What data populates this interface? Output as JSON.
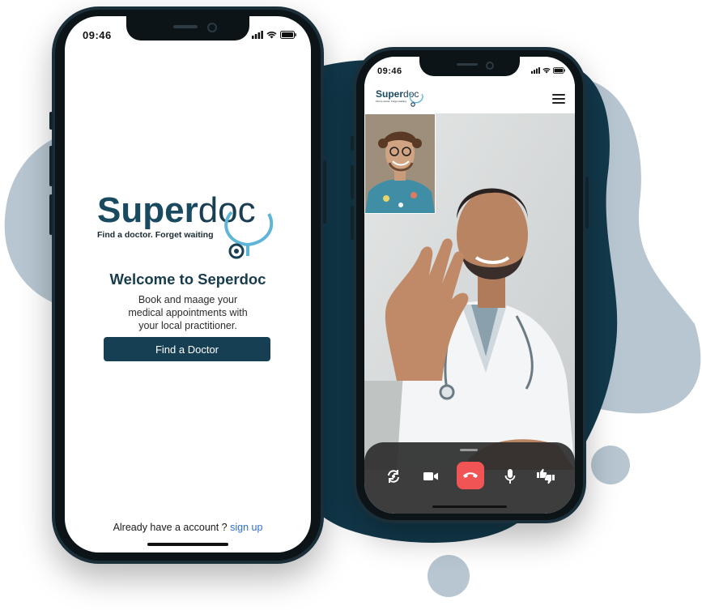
{
  "phone1": {
    "status_time": "09:46",
    "logo": {
      "part1": "Super",
      "part2": "doc",
      "tagline": "Find a doctor. Forget waiting"
    },
    "welcome_title": "Welcome to Seperdoc",
    "description_lines": [
      "Book and maage your",
      "medical appointments with",
      "your local practitioner."
    ],
    "cta_label": "Find a Doctor",
    "signup_prompt": "Already have a account ?",
    "signup_link": "sign up"
  },
  "phone2": {
    "status_time": "09:46",
    "logo": {
      "part1": "Super",
      "part2": "doc",
      "tagline": "Find a doctor. Forget waiting"
    },
    "call_controls": [
      "switch-camera-icon",
      "video-camera-icon",
      "end-call-icon",
      "microphone-icon",
      "thumbs-icon"
    ]
  },
  "colors": {
    "brand_dark": "#163f53",
    "link_blue": "#2f6fd6",
    "end_call_red": "#f05454",
    "blob_light": "#b7c6d1",
    "blob_dark": "#12394b"
  }
}
